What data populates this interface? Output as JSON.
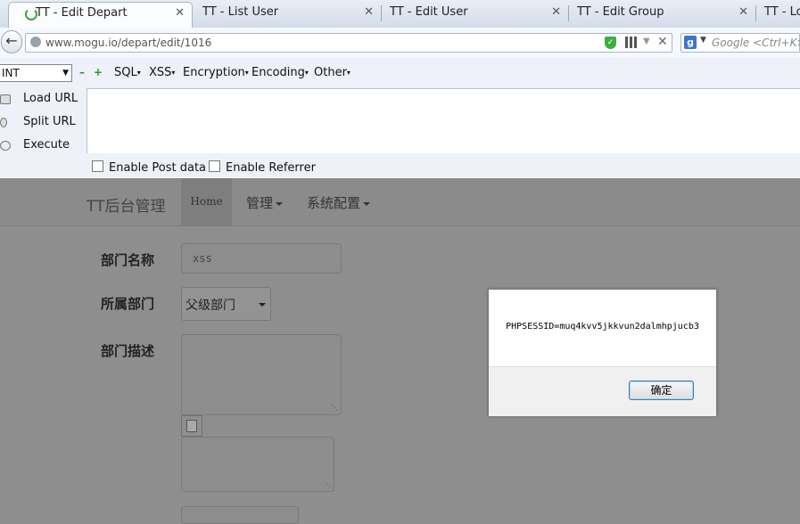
{
  "browser": {
    "tabs": [
      {
        "title": "TT - Edit Depart",
        "active": true
      },
      {
        "title": "TT - List User",
        "active": false
      },
      {
        "title": "TT - Edit User",
        "active": false
      },
      {
        "title": "TT - Edit Group",
        "active": false
      },
      {
        "title": "TT - Lo",
        "active": false
      }
    ],
    "close_glyph": "✕",
    "url": "www.mogu.io/depart/edit/1016",
    "search_placeholder": "Google <Ctrl+K>",
    "search_engine_letter": "g"
  },
  "hackbar": {
    "type_select": "INT",
    "menus": [
      "SQL",
      "XSS",
      "Encryption",
      "Encoding",
      "Other"
    ],
    "actions": [
      "Load URL",
      "Split URL",
      "Execute"
    ],
    "checkboxes": [
      "Enable Post data",
      "Enable Referrer"
    ]
  },
  "site": {
    "brand": "TT后台管理",
    "nav": [
      "Home",
      "管理",
      "系统配置"
    ],
    "form": {
      "name_label": "部门名称",
      "name_value": "xss",
      "parent_label": "所属部门",
      "parent_value": "父级部门",
      "desc_label": "部门描述"
    }
  },
  "alert": {
    "message": "PHPSESSID=muq4kvv5jkkvun2dalmhpjucb3",
    "ok_label": "确定"
  },
  "colors": {
    "overlay": "#8e8e8e",
    "alert_button_border": "#3c7fb1",
    "shield_green": "#3fae3f"
  }
}
